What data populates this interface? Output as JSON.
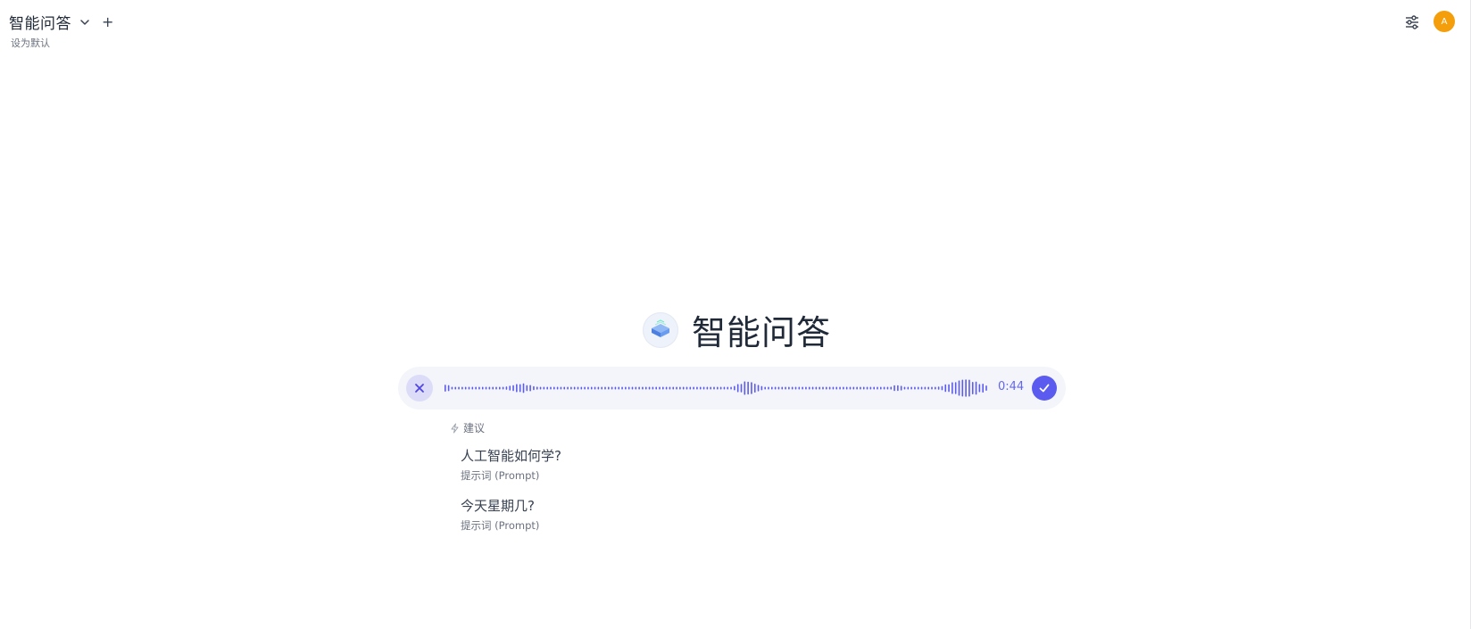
{
  "header": {
    "model_title": "智能问答",
    "add_label": "+",
    "set_default_label": "设为默认"
  },
  "topbar": {
    "controls_icon": "sliders-icon",
    "avatar_initial": "A",
    "avatar_color": "#f59e0b"
  },
  "hero": {
    "title": "智能问答",
    "logo_icon": "model-logo-icon"
  },
  "voice": {
    "timer": "0:44",
    "accent_color": "#5b5bef",
    "cancel_icon": "close-icon",
    "confirm_icon": "check-icon"
  },
  "suggestions": {
    "header_icon": "bolt-icon",
    "header_label": "建议",
    "items": [
      {
        "title": "人工智能如何学?",
        "subtitle": "提示词 (Prompt)"
      },
      {
        "title": "今天星期几?",
        "subtitle": "提示词 (Prompt)"
      }
    ]
  }
}
